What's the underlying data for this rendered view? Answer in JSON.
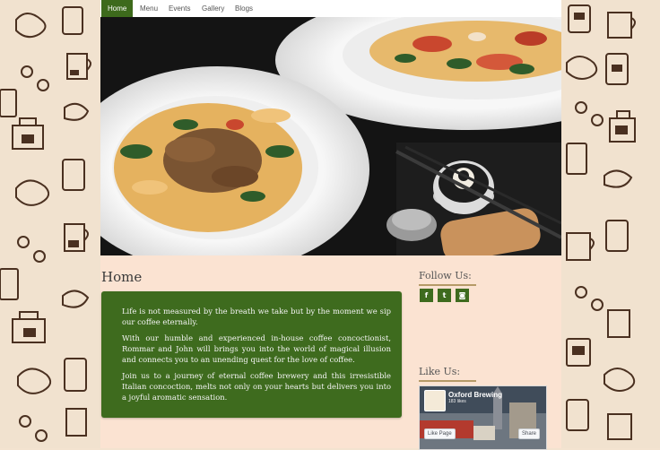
{
  "nav": {
    "items": [
      {
        "label": "Home"
      },
      {
        "label": "Menu"
      },
      {
        "label": "Events"
      },
      {
        "label": "Gallery"
      },
      {
        "label": "Blogs"
      }
    ]
  },
  "hero": {
    "slides_count": 4,
    "active_slide": 1
  },
  "home": {
    "title": "Home",
    "paragraphs": [
      "Life is not measured by the breath we take but by the moment we sip our coffee eternally.",
      "With our humble and experienced in-house coffee concoctionist, Rommar and John will brings you into the world of magical illusion and connects you to an unending quest for the love of coffee.",
      "Join us to a journey of eternal coffee brewery and this irresistible Italian concoction, melts not only on your hearts but delivers you into a joyful aromatic sensation."
    ]
  },
  "follow": {
    "title": "Follow Us:",
    "icons": [
      {
        "name": "facebook-icon",
        "glyph": "f"
      },
      {
        "name": "twitter-icon",
        "glyph": "t"
      },
      {
        "name": "instagram-icon",
        "glyph": "◙"
      }
    ]
  },
  "like": {
    "title": "Like Us:",
    "page_name": "Oxford Brewing",
    "likes_text": "183 likes",
    "like_button": "Like Page",
    "share_button": "Share"
  },
  "colors": {
    "accent_green": "#3e6b1e",
    "page_bg": "#fbe3d2"
  }
}
